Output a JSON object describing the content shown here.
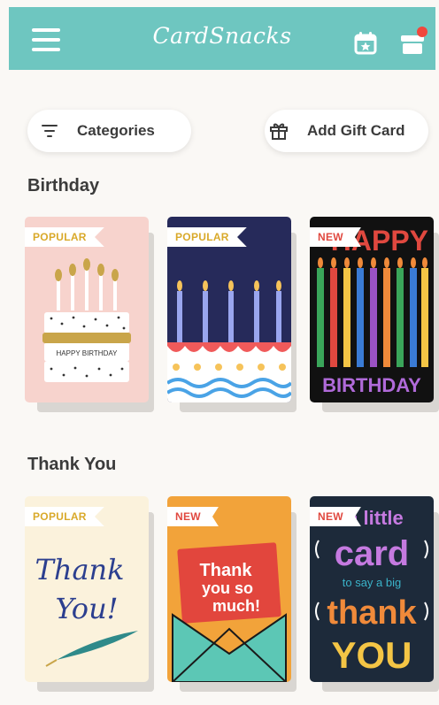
{
  "header": {
    "logo": "CardSnacks",
    "icons": [
      "hamburger-menu-icon",
      "calendar-star-icon",
      "gift-box-icon"
    ]
  },
  "actions": {
    "categories_label": "Categories",
    "add_gift_card_label": "Add Gift Card"
  },
  "sections": [
    {
      "title": "Birthday",
      "cards": [
        {
          "badge": "POPULAR",
          "lines": [
            "HAPPY BIRTHDAY"
          ]
        },
        {
          "badge": "POPULAR",
          "lines": []
        },
        {
          "badge": "NEW",
          "lines": [
            "HAPPY",
            "BIRTHDAY"
          ]
        }
      ]
    },
    {
      "title": "Thank You",
      "cards": [
        {
          "badge": "POPULAR",
          "lines": [
            "Thank",
            "You!"
          ]
        },
        {
          "badge": "NEW",
          "lines": [
            "Thank",
            "you so",
            "much!"
          ]
        },
        {
          "badge": "NEW",
          "lines": [
            "a little",
            "card",
            "to say a big",
            "thank",
            "YOU"
          ]
        }
      ]
    }
  ],
  "colors": {
    "header_bg": "#6ec6c0",
    "popular_badge": "#d9a92a",
    "new_badge": "#e0483f",
    "notification_dot": "#f0473d"
  }
}
